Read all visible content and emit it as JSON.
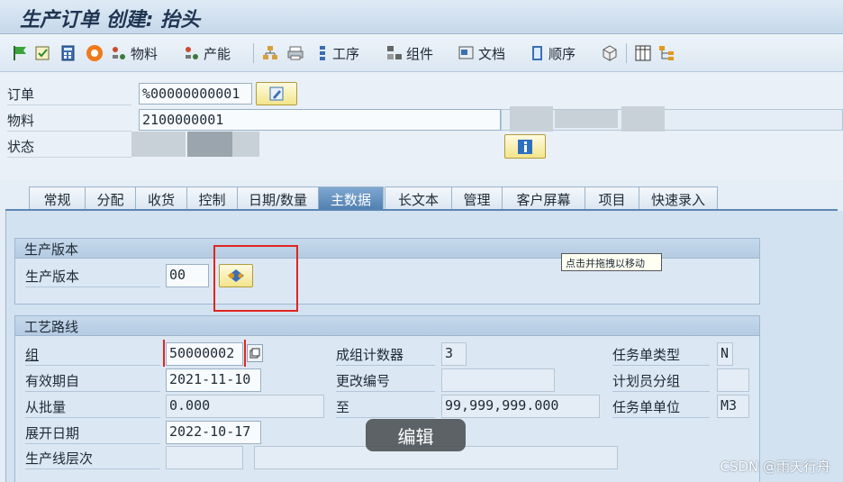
{
  "window": {
    "title": "生产订单 创建: 抬头"
  },
  "toolbar": {
    "material_label": "物料",
    "capacity_label": "产能",
    "operations_label": "工序",
    "components_label": "组件",
    "documents_label": "文档",
    "sequences_label": "顺序"
  },
  "header": {
    "order_label": "订单",
    "order_value": "%00000000001",
    "material_label": "物料",
    "material_value": "2100000001",
    "status_label": "状态"
  },
  "tabs": [
    "常规",
    "分配",
    "收货",
    "控制",
    "日期/数量",
    "主数据",
    "长文本",
    "管理",
    "客户屏幕",
    "项目",
    "快速录入"
  ],
  "active_tab": "主数据",
  "production_version": {
    "section_title": "生产版本",
    "label": "生产版本",
    "value": "00"
  },
  "routing": {
    "section_title": "工艺路线",
    "group_label": "组",
    "group_value": "50000002",
    "valid_from_label": "有效期自",
    "valid_from_value": "2021-11-10",
    "from_lot_label": "从批量",
    "from_lot_value": "0.000",
    "explosion_date_label": "展开日期",
    "explosion_date_value": "2022-10-17",
    "line_hierarchy_label": "生产线层次",
    "group_counter_label": "成组计数器",
    "group_counter_value": "3",
    "change_number_label": "更改编号",
    "change_number_value": "",
    "to_label": "至",
    "to_value": "99,999,999.000",
    "task_list_type_label": "任务单类型",
    "task_list_type_value": "N",
    "planner_group_label": "计划员分组",
    "planner_group_value": "",
    "task_list_unit_label": "任务单单位",
    "task_list_unit_value": "M3"
  },
  "overlay": {
    "tooltip": "点击并拖拽以移动",
    "edit_button": "编辑",
    "watermark": "CSDN @雨天行舟"
  },
  "colors": {
    "accent": "#4f7fb0",
    "highlight_box": "#e0261f",
    "button_yellow": "#f3e58c"
  }
}
